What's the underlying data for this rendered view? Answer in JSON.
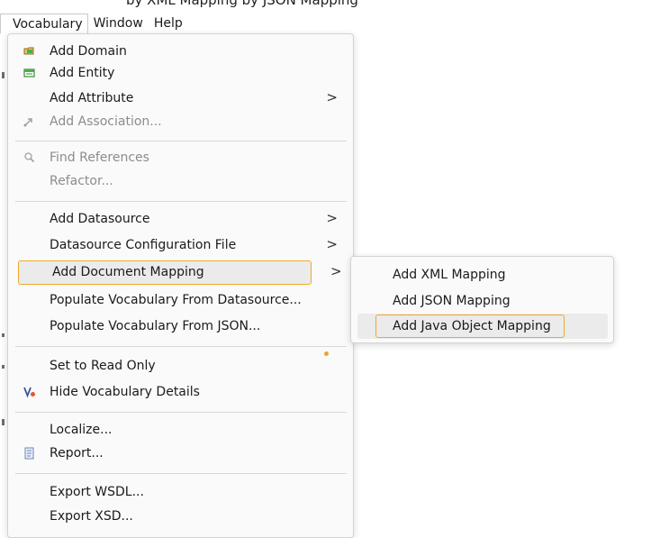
{
  "caption": "by XML Mapping by JSON Mapping",
  "menubar": {
    "items": [
      {
        "label": "Vocabulary",
        "active": true
      },
      {
        "label": "Window",
        "active": false
      },
      {
        "label": "Help",
        "active": false
      }
    ]
  },
  "menu": {
    "add_domain": "Add Domain",
    "add_entity": "Add Entity",
    "add_attribute": "Add Attribute",
    "add_association": "Add Association...",
    "find_references": "Find References",
    "refactor": "Refactor...",
    "add_datasource": "Add Datasource",
    "datasource_config": "Datasource Configuration File",
    "add_document_mapping": "Add Document Mapping",
    "populate_from_datasource": "Populate Vocabulary From Datasource...",
    "populate_from_json": "Populate Vocabulary From JSON...",
    "set_read_only": "Set to Read Only",
    "hide_details": "Hide Vocabulary Details",
    "localize": "Localize...",
    "report": "Report...",
    "export_wsdl": "Export WSDL...",
    "export_xsd": "Export XSD...",
    "submenu_arrow": ">"
  },
  "submenu": {
    "add_xml_mapping": "Add XML Mapping",
    "add_json_mapping": "Add JSON Mapping",
    "add_java_object_mapping": "Add Java Object Mapping"
  },
  "colors": {
    "highlight_border": "#f0a92e",
    "hover_background": "#ebebeb",
    "disabled_text": "#8c8c8c"
  },
  "icons": {
    "add_domain": "domain-add-icon",
    "add_entity": "entity-add-icon",
    "add_association": "association-icon",
    "find_references": "magnifier-icon",
    "hide_details": "vocabulary-v-icon",
    "report": "report-icon"
  }
}
